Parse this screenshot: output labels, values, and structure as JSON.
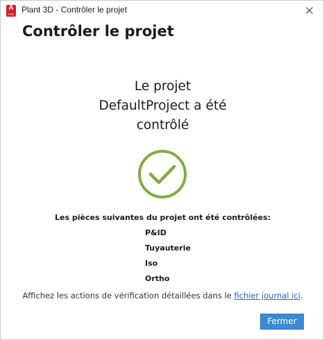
{
  "window": {
    "title": "Plant 3D - Contrôler le projet",
    "app_icon": {
      "name": "autocad-plant3d-app-icon",
      "letter": "A",
      "tag": "P3D",
      "color": "#d0202a"
    },
    "close_icon": "close-icon"
  },
  "dialog": {
    "heading": "Contrôler le projet",
    "status_lines": [
      "Le projet",
      "DefaultProject a été",
      "contrôlé"
    ],
    "success_icon": {
      "name": "check-circle-icon",
      "color": "#7fad3f"
    },
    "parts_heading": "Les pièces suivantes du projet ont été contrôlées:",
    "parts": [
      "P&ID",
      "Tuyauterie",
      "Iso",
      "Ortho"
    ],
    "log_prefix": "Affichez les actions de vérification détaillées dans le ",
    "log_link": "fichier journal ici",
    "log_suffix": ".",
    "close_button": "Fermer"
  },
  "colors": {
    "accent_button": "#3b8bd6",
    "link": "#1b64c2",
    "success": "#7fad3f"
  }
}
